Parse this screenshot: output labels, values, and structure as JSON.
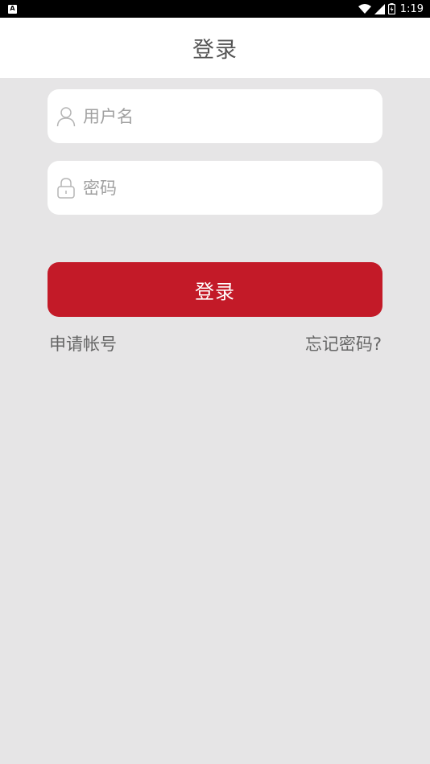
{
  "status_bar": {
    "notification_icon_letter": "A",
    "time": "1:19",
    "icons": [
      "wifi-icon",
      "signal-icon",
      "battery-icon"
    ]
  },
  "header": {
    "title": "登录"
  },
  "form": {
    "username": {
      "placeholder": "用户名",
      "value": "",
      "icon": "user-icon"
    },
    "password": {
      "placeholder": "密码",
      "value": "",
      "icon": "lock-icon"
    },
    "login_label": "登录"
  },
  "links": {
    "register": "申请帐号",
    "forgot_password": "忘记密码?"
  },
  "colors": {
    "accent": "#c31a28",
    "background": "#e6e5e6",
    "header_bg": "#ffffff"
  }
}
